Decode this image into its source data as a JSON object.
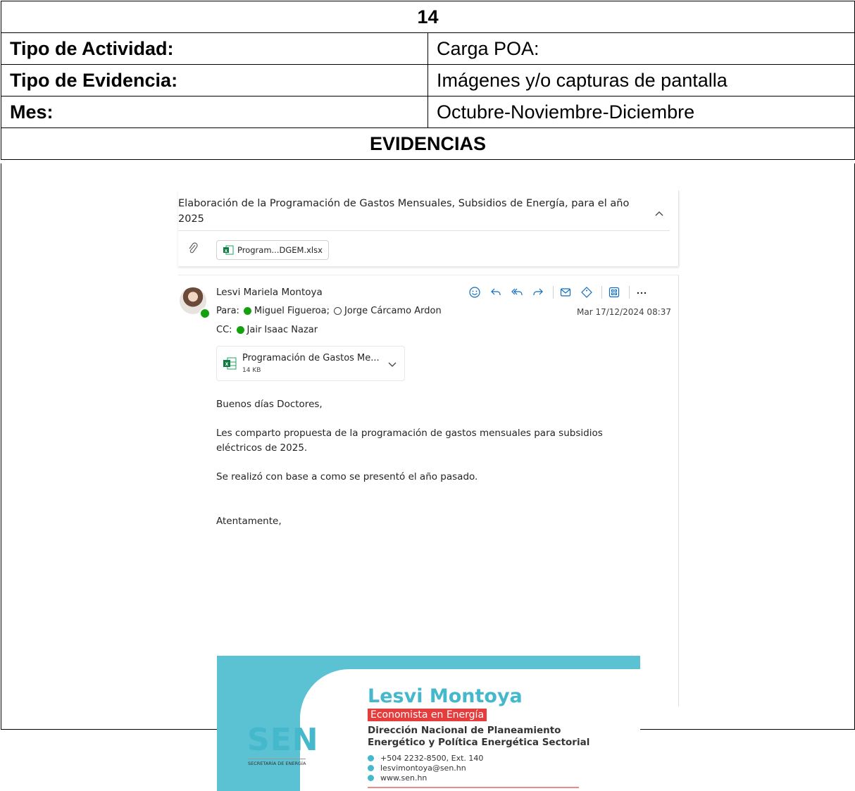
{
  "header": {
    "number": "14",
    "rows": [
      {
        "label": "Tipo de Actividad:",
        "value": "Carga POA:"
      },
      {
        "label": "Tipo de Evidencia:",
        "value": "Imágenes y/o capturas de pantalla"
      },
      {
        "label": "Mes:",
        "value": "Octubre-Noviembre-Diciembre"
      }
    ],
    "section_title": "EVIDENCIAS"
  },
  "email": {
    "subject": "Elaboración de la Programación de Gastos Mensuales, Subsidios de Energía, para el año 2025",
    "attachment_chip": "Program...DGEM.xlsx",
    "sender": "Lesvi Mariela Montoya",
    "to_label": "Para:",
    "to": [
      "Miguel Figueroa;",
      "Jorge Cárcamo Ardon"
    ],
    "cc_label": "CC:",
    "cc": [
      "Jair Isaac Nazar"
    ],
    "date": "Mar 17/12/2024 08:37",
    "file": {
      "name": "Programación de Gastos Me...",
      "size": "14 KB"
    },
    "body": [
      "Buenos días Doctores,",
      "Les comparto propuesta de la programación de gastos mensuales para subsidios eléctricos de 2025.",
      "Se realizó con base a como se presentó el año pasado.",
      "Atentamente,"
    ],
    "signature": {
      "name": "Lesvi Montoya",
      "role": "Economista en Energía",
      "department": "Dirección Nacional de Planeamiento Energético y Política Energética Sectorial",
      "phone": "+504 2232-8500, Ext. 140",
      "email": "lesvimontoya@sen.hn",
      "web": "www.sen.hn",
      "logo_text": "SEN",
      "logo_sub": "SECRETARÍA DE ENERGÍA"
    },
    "icons": [
      "emoji-icon",
      "reply-icon",
      "reply-all-icon",
      "forward-icon",
      "mail-icon",
      "tag-icon",
      "apps-icon",
      "more-icon"
    ]
  }
}
